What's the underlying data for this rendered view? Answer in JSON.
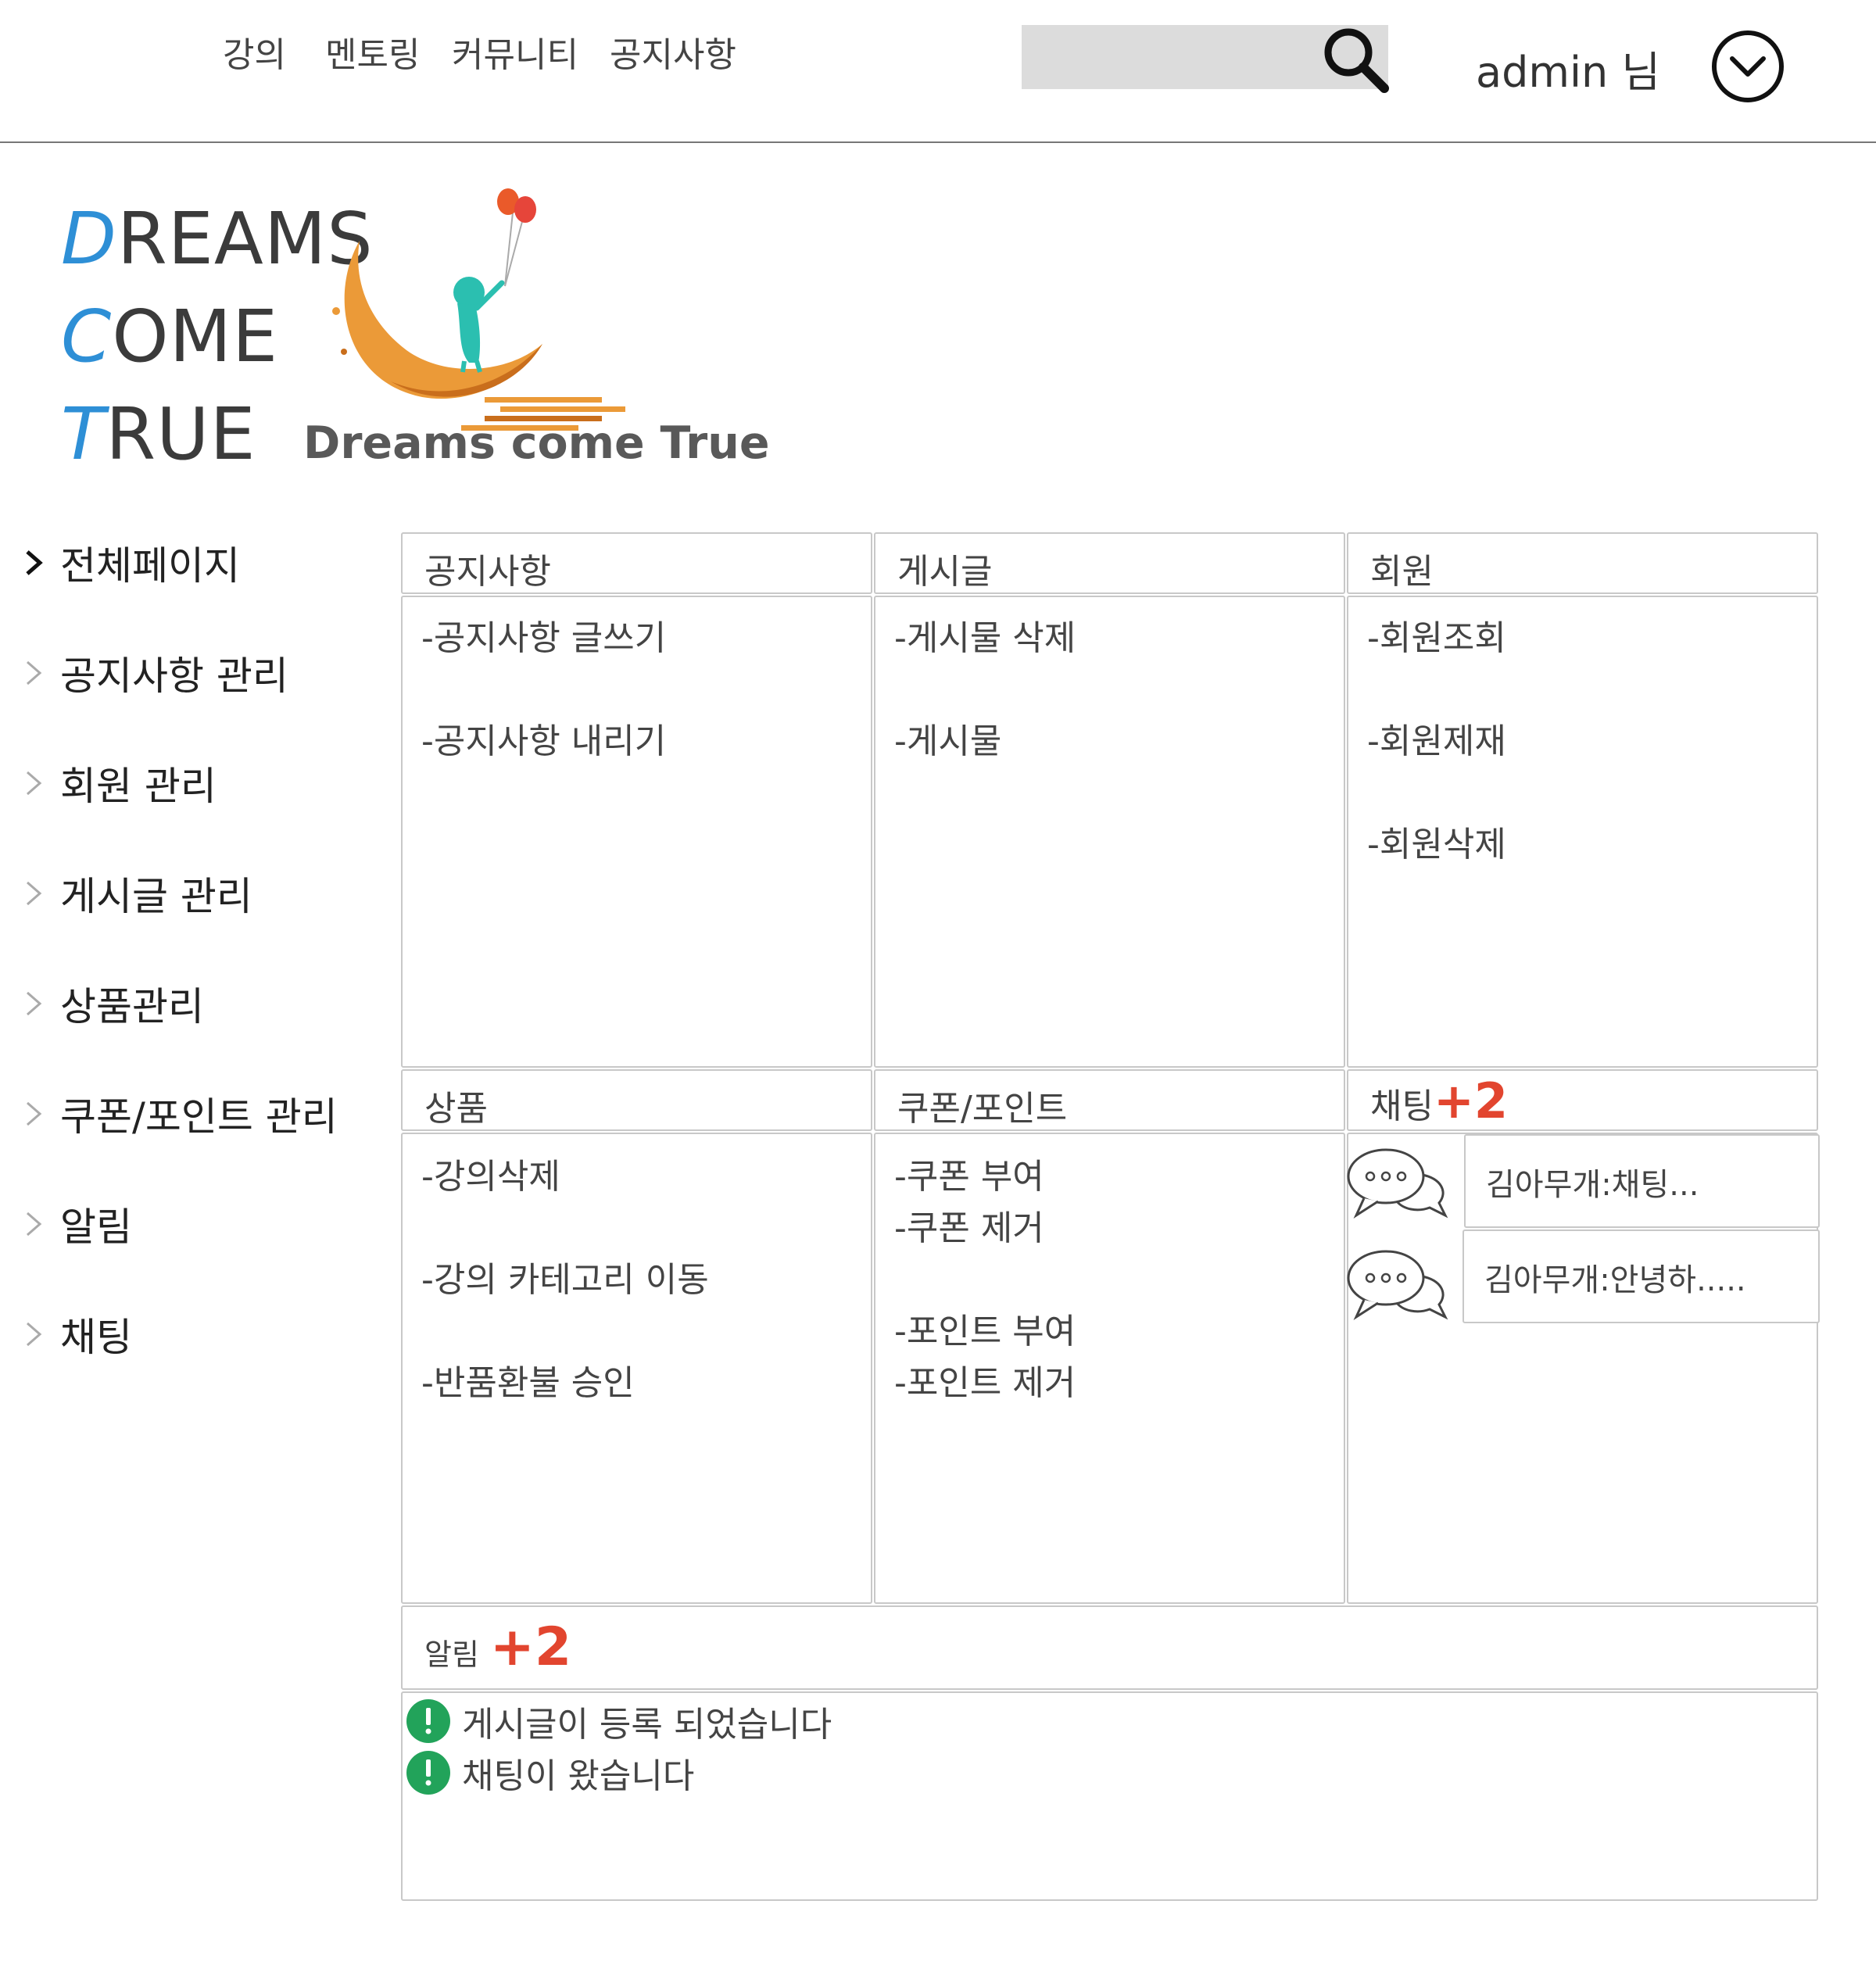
{
  "nav": {
    "links": [
      "강의",
      "멘토링",
      "커뮤니티",
      "공지사항"
    ],
    "user_label": "admin 님"
  },
  "logo": {
    "lines": [
      {
        "cap": "D",
        "rest": "REAMS"
      },
      {
        "cap": "C",
        "rest": "OME"
      },
      {
        "cap": "T",
        "rest": "RUE"
      }
    ],
    "tagline": "Dreams come True"
  },
  "sidebar": {
    "items": [
      {
        "label": "전체페이지",
        "active": true
      },
      {
        "label": "공지사항 관리",
        "active": false
      },
      {
        "label": "회원 관리",
        "active": false
      },
      {
        "label": "게시글 관리",
        "active": false
      },
      {
        "label": "상품관리",
        "active": false
      },
      {
        "label": "쿠폰/포인트 관리",
        "active": false
      },
      {
        "label": "알림",
        "active": false
      },
      {
        "label": "채팅",
        "active": false
      }
    ]
  },
  "panels": {
    "notice": {
      "title": "공지사항",
      "items": [
        "-공지사항 글쓰기",
        "-공지사항 내리기"
      ]
    },
    "posts": {
      "title": "게시글",
      "items": [
        "-게시물 삭제",
        "-게시물"
      ]
    },
    "members": {
      "title": "회원",
      "items": [
        "-회원조회",
        "-회원제재",
        "-회원삭제"
      ]
    },
    "products": {
      "title": "상품",
      "items": [
        "-강의삭제",
        "-강의 카테고리 이동",
        "-반품환불 승인"
      ]
    },
    "coupons": {
      "title": "쿠폰/포인트",
      "items": [
        "-쿠폰 부여",
        "-쿠폰 제거",
        "-포인트 부여",
        "-포인트 제거"
      ]
    },
    "chat": {
      "title": "채팅",
      "badge": "+2",
      "messages": [
        "김아무개:채팅...",
        "김아무개:안녕하....."
      ]
    },
    "alerts": {
      "title": "알림",
      "badge": "+2",
      "items": [
        "게시글이 등록 되었습니다",
        "채팅이 왔습니다"
      ]
    }
  },
  "colors": {
    "accent_blue": "#2e8fd6",
    "badge_red": "#e2452f",
    "alert_green": "#22a35a",
    "border": "#c8c8c8"
  }
}
